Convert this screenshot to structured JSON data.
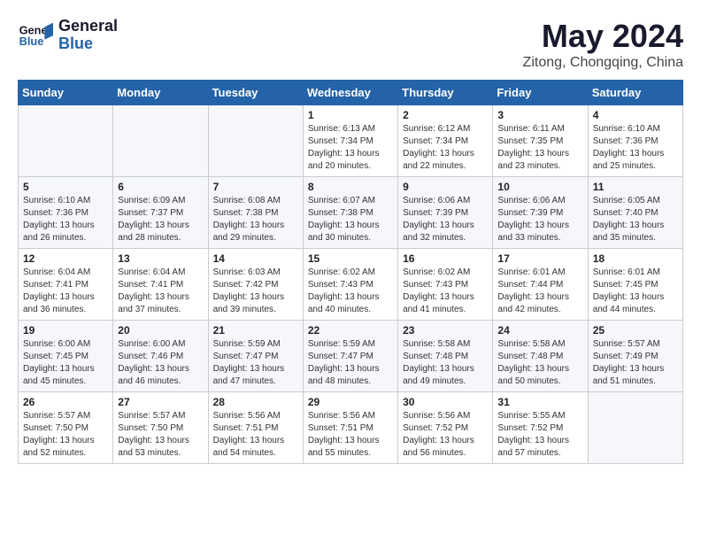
{
  "header": {
    "logo_line1": "General",
    "logo_line2": "Blue",
    "title": "May 2024",
    "location": "Zitong, Chongqing, China"
  },
  "weekdays": [
    "Sunday",
    "Monday",
    "Tuesday",
    "Wednesday",
    "Thursday",
    "Friday",
    "Saturday"
  ],
  "weeks": [
    [
      {
        "day": "",
        "info": ""
      },
      {
        "day": "",
        "info": ""
      },
      {
        "day": "",
        "info": ""
      },
      {
        "day": "1",
        "info": "Sunrise: 6:13 AM\nSunset: 7:34 PM\nDaylight: 13 hours\nand 20 minutes."
      },
      {
        "day": "2",
        "info": "Sunrise: 6:12 AM\nSunset: 7:34 PM\nDaylight: 13 hours\nand 22 minutes."
      },
      {
        "day": "3",
        "info": "Sunrise: 6:11 AM\nSunset: 7:35 PM\nDaylight: 13 hours\nand 23 minutes."
      },
      {
        "day": "4",
        "info": "Sunrise: 6:10 AM\nSunset: 7:36 PM\nDaylight: 13 hours\nand 25 minutes."
      }
    ],
    [
      {
        "day": "5",
        "info": "Sunrise: 6:10 AM\nSunset: 7:36 PM\nDaylight: 13 hours\nand 26 minutes."
      },
      {
        "day": "6",
        "info": "Sunrise: 6:09 AM\nSunset: 7:37 PM\nDaylight: 13 hours\nand 28 minutes."
      },
      {
        "day": "7",
        "info": "Sunrise: 6:08 AM\nSunset: 7:38 PM\nDaylight: 13 hours\nand 29 minutes."
      },
      {
        "day": "8",
        "info": "Sunrise: 6:07 AM\nSunset: 7:38 PM\nDaylight: 13 hours\nand 30 minutes."
      },
      {
        "day": "9",
        "info": "Sunrise: 6:06 AM\nSunset: 7:39 PM\nDaylight: 13 hours\nand 32 minutes."
      },
      {
        "day": "10",
        "info": "Sunrise: 6:06 AM\nSunset: 7:39 PM\nDaylight: 13 hours\nand 33 minutes."
      },
      {
        "day": "11",
        "info": "Sunrise: 6:05 AM\nSunset: 7:40 PM\nDaylight: 13 hours\nand 35 minutes."
      }
    ],
    [
      {
        "day": "12",
        "info": "Sunrise: 6:04 AM\nSunset: 7:41 PM\nDaylight: 13 hours\nand 36 minutes."
      },
      {
        "day": "13",
        "info": "Sunrise: 6:04 AM\nSunset: 7:41 PM\nDaylight: 13 hours\nand 37 minutes."
      },
      {
        "day": "14",
        "info": "Sunrise: 6:03 AM\nSunset: 7:42 PM\nDaylight: 13 hours\nand 39 minutes."
      },
      {
        "day": "15",
        "info": "Sunrise: 6:02 AM\nSunset: 7:43 PM\nDaylight: 13 hours\nand 40 minutes."
      },
      {
        "day": "16",
        "info": "Sunrise: 6:02 AM\nSunset: 7:43 PM\nDaylight: 13 hours\nand 41 minutes."
      },
      {
        "day": "17",
        "info": "Sunrise: 6:01 AM\nSunset: 7:44 PM\nDaylight: 13 hours\nand 42 minutes."
      },
      {
        "day": "18",
        "info": "Sunrise: 6:01 AM\nSunset: 7:45 PM\nDaylight: 13 hours\nand 44 minutes."
      }
    ],
    [
      {
        "day": "19",
        "info": "Sunrise: 6:00 AM\nSunset: 7:45 PM\nDaylight: 13 hours\nand 45 minutes."
      },
      {
        "day": "20",
        "info": "Sunrise: 6:00 AM\nSunset: 7:46 PM\nDaylight: 13 hours\nand 46 minutes."
      },
      {
        "day": "21",
        "info": "Sunrise: 5:59 AM\nSunset: 7:47 PM\nDaylight: 13 hours\nand 47 minutes."
      },
      {
        "day": "22",
        "info": "Sunrise: 5:59 AM\nSunset: 7:47 PM\nDaylight: 13 hours\nand 48 minutes."
      },
      {
        "day": "23",
        "info": "Sunrise: 5:58 AM\nSunset: 7:48 PM\nDaylight: 13 hours\nand 49 minutes."
      },
      {
        "day": "24",
        "info": "Sunrise: 5:58 AM\nSunset: 7:48 PM\nDaylight: 13 hours\nand 50 minutes."
      },
      {
        "day": "25",
        "info": "Sunrise: 5:57 AM\nSunset: 7:49 PM\nDaylight: 13 hours\nand 51 minutes."
      }
    ],
    [
      {
        "day": "26",
        "info": "Sunrise: 5:57 AM\nSunset: 7:50 PM\nDaylight: 13 hours\nand 52 minutes."
      },
      {
        "day": "27",
        "info": "Sunrise: 5:57 AM\nSunset: 7:50 PM\nDaylight: 13 hours\nand 53 minutes."
      },
      {
        "day": "28",
        "info": "Sunrise: 5:56 AM\nSunset: 7:51 PM\nDaylight: 13 hours\nand 54 minutes."
      },
      {
        "day": "29",
        "info": "Sunrise: 5:56 AM\nSunset: 7:51 PM\nDaylight: 13 hours\nand 55 minutes."
      },
      {
        "day": "30",
        "info": "Sunrise: 5:56 AM\nSunset: 7:52 PM\nDaylight: 13 hours\nand 56 minutes."
      },
      {
        "day": "31",
        "info": "Sunrise: 5:55 AM\nSunset: 7:52 PM\nDaylight: 13 hours\nand 57 minutes."
      },
      {
        "day": "",
        "info": ""
      }
    ]
  ]
}
